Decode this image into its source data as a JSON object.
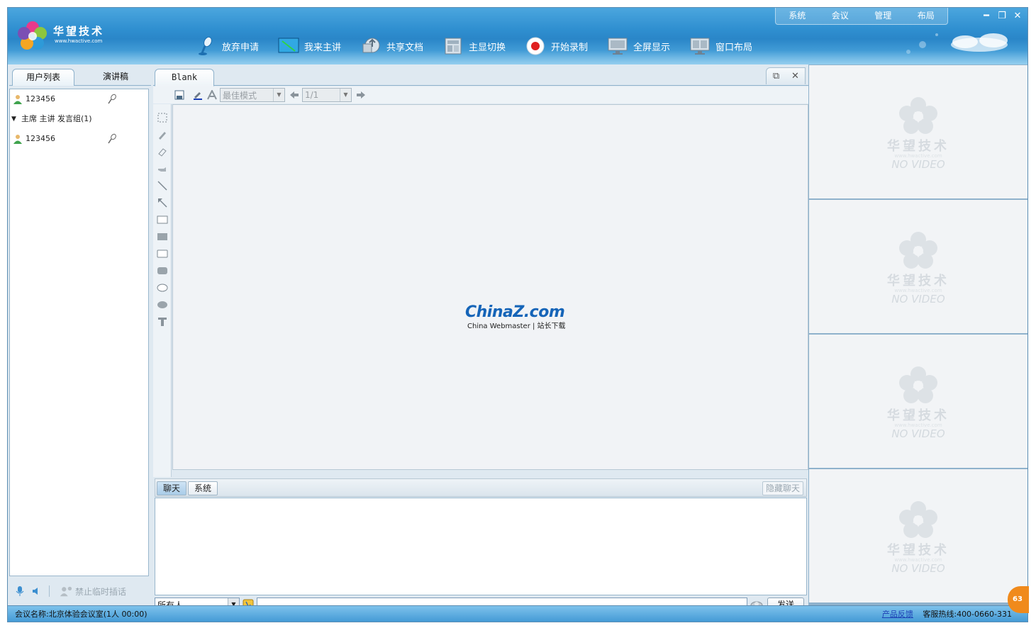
{
  "app": {
    "logo_name": "华望技术",
    "logo_url": "www.hwactive.com"
  },
  "top_menu": [
    "系统",
    "会议",
    "管理",
    "布局"
  ],
  "window_controls": [
    "minimize-icon",
    "restore-icon",
    "close-icon"
  ],
  "toolbar": [
    {
      "label": "放弃申请",
      "icon": "microphone-icon"
    },
    {
      "label": "我来主讲",
      "icon": "presenter-screen-icon"
    },
    {
      "label": "共享文档",
      "icon": "share-document-icon"
    },
    {
      "label": "主显切换",
      "icon": "main-display-switch-icon"
    },
    {
      "label": "开始录制",
      "icon": "record-icon"
    },
    {
      "label": "全屏显示",
      "icon": "fullscreen-icon"
    },
    {
      "label": "窗口布局",
      "icon": "window-layout-icon"
    }
  ],
  "left_panel": {
    "tabs": [
      "用户列表",
      "演讲稿"
    ],
    "active_tab": "用户列表",
    "users_top": [
      {
        "name": "123456"
      }
    ],
    "group": {
      "name": "主席 主讲 发言组(1)",
      "expanded": true
    },
    "group_users": [
      {
        "name": "123456"
      }
    ],
    "bottom_label": "禁止临时插话"
  },
  "document": {
    "tab_label": "Blank",
    "view_mode": "最佳模式",
    "page": "1/1",
    "watermark_main": "ChinaZ.com",
    "watermark_sub": "China Webmaster | 站长下载"
  },
  "chat": {
    "tabs": [
      "聊天",
      "系统"
    ],
    "active_tab": "聊天",
    "hide_button": "隐藏聊天",
    "recipient": "所有人",
    "send_button": "发送"
  },
  "videos": [
    {
      "brand": "华望技术",
      "url": "www.hwactive.com",
      "status": "NO VIDEO"
    },
    {
      "brand": "华望技术",
      "url": "www.hwactive.com",
      "status": "NO VIDEO"
    },
    {
      "brand": "华望技术",
      "url": "www.hwactive.com",
      "status": "NO VIDEO"
    },
    {
      "brand": "华望技术",
      "url": "www.hwactive.com",
      "status": "NO VIDEO"
    }
  ],
  "status_bar": {
    "meeting_info": "会议名称:北京体验会议室(1人 00:00)",
    "feedback_link": "产品反馈",
    "hotline": "客服热线:400-0660-331",
    "badge": "63"
  },
  "colors": {
    "header_blue": "#2f8fd0",
    "panel_bg": "#dfe9f1",
    "record_red": "#e02020",
    "badge_orange": "#f08a1c"
  }
}
